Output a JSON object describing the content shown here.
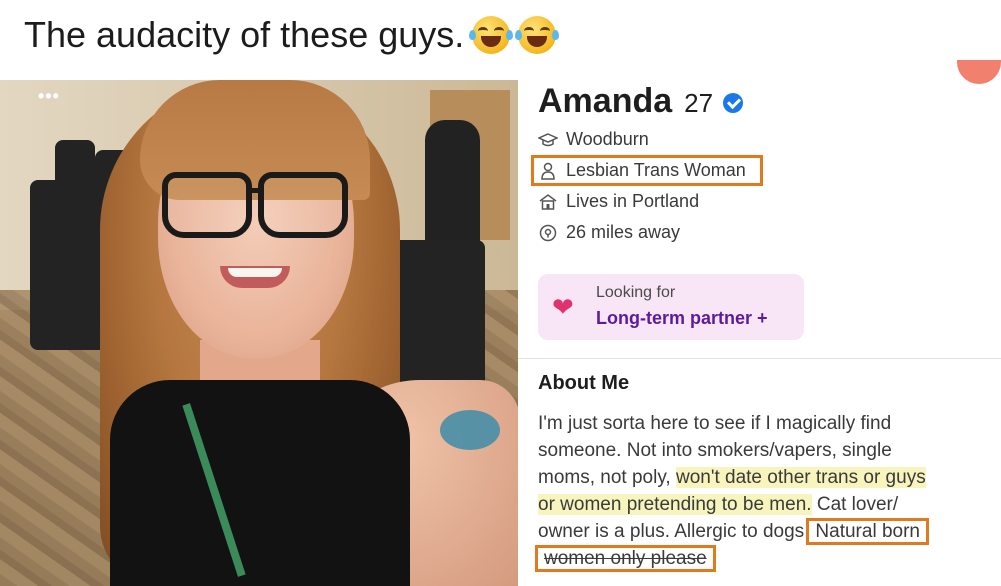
{
  "caption": {
    "text": "The audacity of these guys.",
    "emoji": [
      "tears-of-joy-emoji",
      "tears-of-joy-emoji"
    ]
  },
  "photo": {
    "menu_dots": "•••"
  },
  "profile": {
    "name": "Amanda",
    "age": "27",
    "attributes": [
      {
        "icon": "school-icon",
        "text": "Woodburn",
        "highlighted": false
      },
      {
        "icon": "person-icon",
        "text": "Lesbian Trans Woman",
        "highlighted": true
      },
      {
        "icon": "home-icon",
        "text": "Lives in Portland",
        "highlighted": false
      },
      {
        "icon": "location-pin-icon",
        "text": "26 miles away",
        "highlighted": false
      }
    ],
    "looking_for": {
      "icon": "heart-icon",
      "label": "Looking for",
      "value": "Long-term partner +"
    },
    "about": {
      "title": "About Me",
      "lines": {
        "l1": "I'm just sorta here to see if I magically find",
        "l2": "someone. Not into smokers/vapers, single",
        "l3a": "moms, not poly, ",
        "l3b": "won't date other trans or guys",
        "l4a": "or women pretending to be men.",
        "l4b": " Cat lover/",
        "l5a": "owner is a plus. Allergic to dogs",
        "l5b": "Natural born",
        "l6": "women only please"
      }
    }
  },
  "colors": {
    "highlight_box": "#e07a1f",
    "text_highlight": "#f7f5bd",
    "verified": "#1b78e8",
    "looking_bg": "#f8e6f6",
    "looking_value": "#5b1aa0"
  }
}
